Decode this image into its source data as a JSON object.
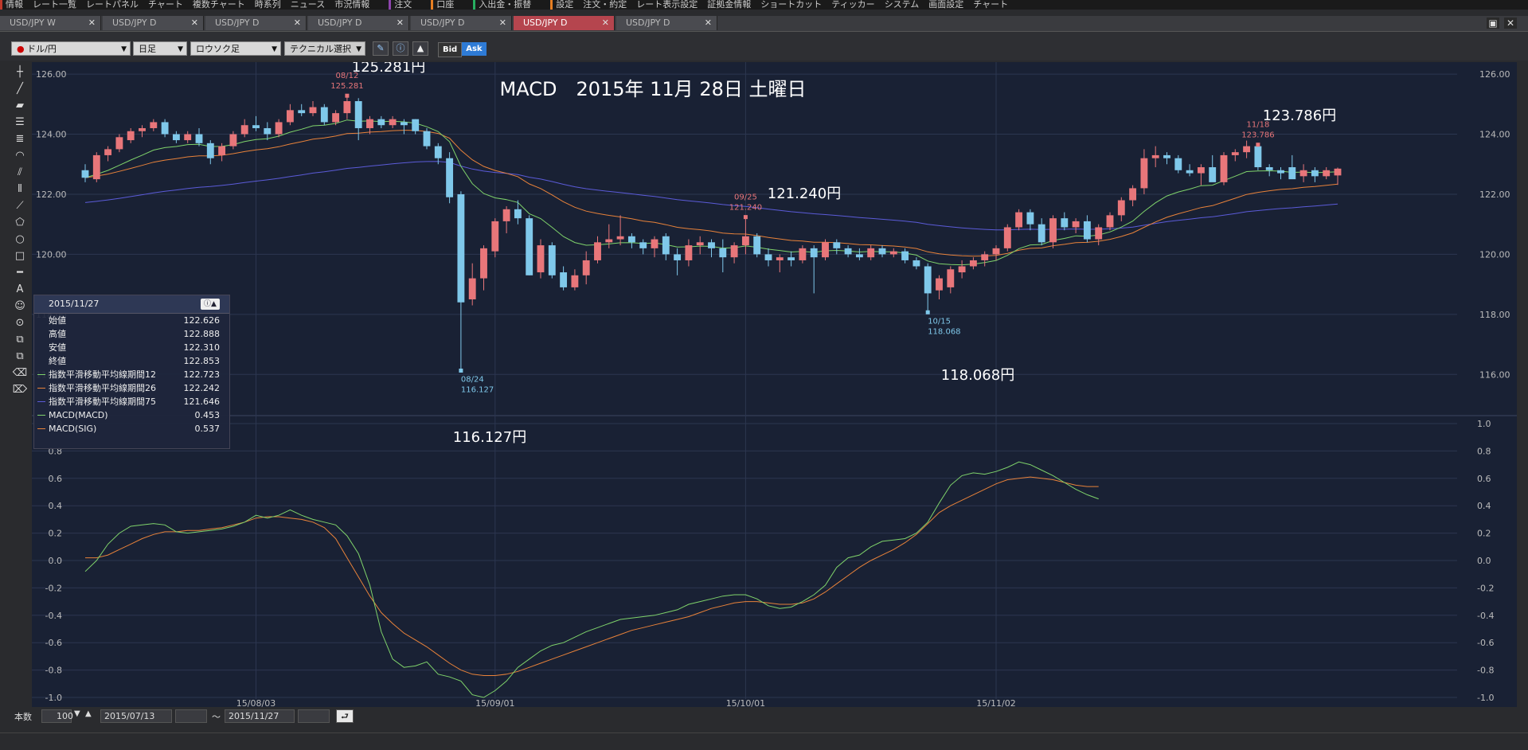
{
  "menu": {
    "groups": [
      {
        "items": [
          "情報",
          "レート一覧",
          "レートパネル",
          "チャート",
          "複数チャート",
          "時系列",
          "ニュース",
          "市況情報"
        ]
      },
      {
        "items": [
          "注文"
        ]
      },
      {
        "items": [
          "口座"
        ]
      },
      {
        "items": [
          "入出金・振替"
        ]
      },
      {
        "items": [
          "設定",
          "注文・約定",
          "レート表示設定",
          "証拠金情報",
          "ショートカット",
          "ティッカー",
          "システム",
          "画面設定",
          "チャート"
        ]
      }
    ]
  },
  "tabs": [
    {
      "label": "USD/JPY W",
      "active": false
    },
    {
      "label": "USD/JPY D",
      "active": false
    },
    {
      "label": "USD/JPY D",
      "active": false
    },
    {
      "label": "USD/JPY D",
      "active": false
    },
    {
      "label": "USD/JPY D",
      "active": false
    },
    {
      "label": "USD/JPY D",
      "active": true
    },
    {
      "label": "USD/JPY D",
      "active": false
    }
  ],
  "toolbar": {
    "pair": "ドル/円",
    "timeframe": "日足",
    "chart_type": "ロウソク足",
    "technical": "テクニカル選択",
    "bid": "Bid",
    "ask": "Ask"
  },
  "chart_title": "MACD　2015年 11月 28日 土曜日",
  "annotations": [
    {
      "big": "125.281円",
      "date": "08/12",
      "price": "125.281"
    },
    {
      "big": "121.240円",
      "date": "09/25",
      "price": "121.240"
    },
    {
      "big": "123.786円",
      "date": "11/18",
      "price": "123.786"
    },
    {
      "big": "116.127円",
      "date": "08/24",
      "price": "116.127"
    },
    {
      "big": "118.068円",
      "date": "10/15",
      "price": "118.068"
    }
  ],
  "info": {
    "date": "2015/11/27",
    "rows": [
      {
        "label": "始値",
        "value": "122.626"
      },
      {
        "label": "高値",
        "value": "122.888"
      },
      {
        "label": "安値",
        "value": "122.310"
      },
      {
        "label": "終値",
        "value": "122.853"
      },
      {
        "label": "指数平滑移動平均線期間12",
        "value": "122.723",
        "color": "#7fd36b"
      },
      {
        "label": "指数平滑移動平均線期間26",
        "value": "122.242",
        "color": "#e8823a"
      },
      {
        "label": "指数平滑移動平均線期間75",
        "value": "121.646",
        "color": "#5b5bd8"
      },
      {
        "label": "MACD(MACD)",
        "value": "0.453",
        "color": "#7fd36b"
      },
      {
        "label": "MACD(SIG)",
        "value": "0.537",
        "color": "#e8823a"
      }
    ]
  },
  "bottom": {
    "count_label": "本数",
    "count": "100",
    "from": "2015/07/13",
    "tilde": "～",
    "to": "2015/11/27"
  },
  "chart_data": {
    "type": "candlestick",
    "price_ticks": [
      "126.00",
      "124.00",
      "122.00",
      "120.00",
      "118.00",
      "116.00"
    ],
    "price_range": [
      115.0,
      126.4
    ],
    "macd_ticks": [
      "1.0",
      "0.8",
      "0.6",
      "0.4",
      "0.2",
      "0.0",
      "-0.2",
      "-0.4",
      "-0.6",
      "-0.8",
      "-1.0"
    ],
    "macd_range": [
      -1.0,
      1.0
    ],
    "x_labels": [
      {
        "label": "15/08/03",
        "index": 15
      },
      {
        "label": "15/09/01",
        "index": 36
      },
      {
        "label": "15/10/01",
        "index": 58
      },
      {
        "label": "15/11/02",
        "index": 80
      }
    ],
    "ohlc": [
      [
        122.8,
        123.0,
        122.4,
        122.55
      ],
      [
        122.5,
        123.4,
        122.4,
        123.3
      ],
      [
        123.3,
        123.6,
        123.1,
        123.5
      ],
      [
        123.5,
        124.0,
        123.4,
        123.9
      ],
      [
        123.8,
        124.2,
        123.7,
        124.1
      ],
      [
        124.1,
        124.3,
        123.9,
        124.2
      ],
      [
        124.2,
        124.5,
        124.1,
        124.4
      ],
      [
        124.4,
        124.5,
        123.9,
        124.0
      ],
      [
        124.0,
        124.1,
        123.7,
        123.8
      ],
      [
        123.8,
        124.1,
        123.7,
        124.0
      ],
      [
        124.0,
        124.2,
        123.6,
        123.7
      ],
      [
        123.7,
        123.8,
        123.0,
        123.2
      ],
      [
        123.3,
        123.7,
        123.1,
        123.6
      ],
      [
        123.6,
        124.1,
        123.5,
        124.0
      ],
      [
        124.0,
        124.5,
        123.9,
        124.3
      ],
      [
        124.3,
        124.6,
        124.1,
        124.2
      ],
      [
        124.2,
        124.4,
        123.8,
        124.0
      ],
      [
        124.0,
        124.5,
        123.9,
        124.4
      ],
      [
        124.4,
        125.0,
        124.3,
        124.8
      ],
      [
        124.8,
        125.0,
        124.6,
        124.7
      ],
      [
        124.7,
        125.1,
        124.6,
        124.9
      ],
      [
        124.9,
        125.0,
        124.3,
        124.4
      ],
      [
        124.4,
        124.8,
        124.3,
        124.7
      ],
      [
        124.7,
        125.281,
        124.5,
        125.1
      ],
      [
        125.1,
        125.2,
        123.8,
        124.2
      ],
      [
        124.2,
        124.6,
        124.0,
        124.5
      ],
      [
        124.5,
        124.6,
        124.2,
        124.3
      ],
      [
        124.3,
        124.6,
        124.2,
        124.5
      ],
      [
        124.4,
        124.5,
        124.0,
        124.3
      ],
      [
        124.5,
        124.5,
        124.0,
        124.1
      ],
      [
        124.1,
        124.2,
        123.5,
        123.6
      ],
      [
        123.6,
        123.7,
        123.0,
        123.2
      ],
      [
        123.2,
        123.4,
        121.7,
        121.9
      ],
      [
        122.0,
        122.1,
        116.127,
        118.4
      ],
      [
        118.5,
        119.7,
        118.3,
        119.2
      ],
      [
        119.2,
        120.3,
        118.8,
        120.2
      ],
      [
        120.1,
        121.2,
        119.9,
        121.1
      ],
      [
        121.1,
        121.6,
        120.7,
        121.5
      ],
      [
        121.5,
        121.8,
        121.0,
        121.2
      ],
      [
        121.2,
        121.3,
        119.3,
        119.3
      ],
      [
        119.4,
        120.5,
        119.2,
        120.3
      ],
      [
        120.3,
        120.4,
        119.2,
        119.3
      ],
      [
        119.4,
        119.6,
        118.8,
        118.9
      ],
      [
        118.9,
        119.5,
        118.8,
        119.3
      ],
      [
        119.3,
        120.1,
        119.0,
        119.8
      ],
      [
        119.8,
        120.6,
        119.7,
        120.4
      ],
      [
        120.4,
        121.0,
        120.2,
        120.5
      ],
      [
        120.5,
        121.3,
        120.3,
        120.6
      ],
      [
        120.6,
        120.7,
        120.2,
        120.4
      ],
      [
        120.4,
        120.5,
        120.0,
        120.2
      ],
      [
        120.2,
        120.6,
        119.9,
        120.5
      ],
      [
        120.6,
        120.7,
        119.8,
        120.0
      ],
      [
        120.0,
        120.2,
        119.3,
        119.8
      ],
      [
        119.8,
        120.5,
        119.6,
        120.3
      ],
      [
        120.3,
        120.6,
        120.0,
        120.4
      ],
      [
        120.4,
        120.5,
        119.9,
        120.2
      ],
      [
        120.2,
        120.5,
        119.4,
        119.9
      ],
      [
        119.9,
        120.4,
        119.7,
        120.3
      ],
      [
        120.3,
        121.24,
        120.0,
        120.6
      ],
      [
        120.6,
        120.7,
        119.9,
        120.0
      ],
      [
        120.0,
        120.2,
        119.6,
        119.8
      ],
      [
        119.8,
        120.0,
        119.4,
        119.9
      ],
      [
        119.9,
        120.1,
        119.6,
        119.8
      ],
      [
        119.8,
        120.3,
        119.7,
        120.2
      ],
      [
        120.2,
        120.3,
        118.7,
        119.9
      ],
      [
        119.9,
        120.5,
        119.8,
        120.4
      ],
      [
        120.4,
        120.5,
        120.0,
        120.2
      ],
      [
        120.2,
        120.3,
        119.9,
        120.0
      ],
      [
        120.0,
        120.2,
        119.8,
        119.9
      ],
      [
        119.9,
        120.3,
        119.8,
        120.2
      ],
      [
        120.2,
        120.3,
        119.9,
        120.0
      ],
      [
        120.0,
        120.2,
        119.9,
        120.1
      ],
      [
        120.1,
        120.2,
        119.7,
        119.8
      ],
      [
        119.8,
        119.9,
        119.5,
        119.6
      ],
      [
        119.6,
        119.7,
        118.068,
        118.7
      ],
      [
        118.8,
        119.3,
        118.5,
        119.2
      ],
      [
        118.9,
        119.6,
        118.7,
        119.5
      ],
      [
        119.4,
        119.8,
        119.2,
        119.6
      ],
      [
        119.6,
        119.9,
        119.5,
        119.8
      ],
      [
        119.8,
        120.1,
        119.6,
        120.0
      ],
      [
        120.0,
        120.3,
        119.8,
        120.2
      ],
      [
        120.2,
        121.0,
        120.1,
        120.9
      ],
      [
        120.9,
        121.5,
        120.8,
        121.4
      ],
      [
        121.4,
        121.5,
        120.8,
        121.0
      ],
      [
        121.0,
        121.2,
        120.3,
        120.4
      ],
      [
        120.4,
        121.3,
        120.2,
        121.2
      ],
      [
        121.2,
        121.4,
        120.8,
        120.9
      ],
      [
        120.9,
        121.2,
        120.7,
        121.1
      ],
      [
        121.1,
        121.3,
        120.4,
        120.5
      ],
      [
        120.5,
        121.0,
        120.3,
        120.9
      ],
      [
        120.9,
        121.4,
        120.8,
        121.3
      ],
      [
        121.3,
        121.9,
        121.1,
        121.8
      ],
      [
        121.8,
        122.3,
        121.6,
        122.2
      ],
      [
        122.2,
        123.5,
        122.0,
        123.2
      ],
      [
        123.2,
        123.6,
        122.9,
        123.3
      ],
      [
        123.3,
        123.4,
        123.0,
        123.2
      ],
      [
        123.2,
        123.3,
        122.7,
        122.8
      ],
      [
        122.8,
        123.0,
        122.6,
        122.7
      ],
      [
        122.7,
        123.0,
        122.3,
        122.9
      ],
      [
        122.9,
        123.3,
        122.5,
        122.4
      ],
      [
        122.4,
        123.4,
        122.3,
        123.3
      ],
      [
        123.3,
        123.5,
        123.1,
        123.4
      ],
      [
        123.4,
        123.786,
        123.2,
        123.6
      ],
      [
        123.6,
        123.65,
        122.8,
        122.9
      ],
      [
        122.9,
        123.0,
        122.6,
        122.8
      ],
      [
        122.8,
        122.9,
        122.5,
        122.7
      ],
      [
        122.9,
        123.3,
        122.6,
        122.5
      ],
      [
        122.6,
        123.0,
        122.4,
        122.8
      ],
      [
        122.8,
        122.9,
        122.4,
        122.6
      ],
      [
        122.6,
        122.9,
        122.5,
        122.8
      ],
      [
        122.626,
        122.888,
        122.31,
        122.853
      ]
    ],
    "macd": [
      -0.08,
      0.0,
      0.12,
      0.2,
      0.25,
      0.26,
      0.27,
      0.26,
      0.21,
      0.2,
      0.21,
      0.22,
      0.23,
      0.25,
      0.28,
      0.33,
      0.31,
      0.33,
      0.37,
      0.33,
      0.3,
      0.28,
      0.26,
      0.18,
      0.05,
      -0.18,
      -0.52,
      -0.72,
      -0.78,
      -0.77,
      -0.74,
      -0.83,
      -0.85,
      -0.88,
      -0.98,
      -1.0,
      -0.95,
      -0.88,
      -0.78,
      -0.72,
      -0.66,
      -0.62,
      -0.6,
      -0.56,
      -0.52,
      -0.49,
      -0.46,
      -0.43,
      -0.42,
      -0.41,
      -0.4,
      -0.38,
      -0.36,
      -0.32,
      -0.3,
      -0.28,
      -0.26,
      -0.25,
      -0.25,
      -0.28,
      -0.33,
      -0.35,
      -0.34,
      -0.3,
      -0.25,
      -0.18,
      -0.05,
      0.02,
      0.04,
      0.1,
      0.14,
      0.15,
      0.16,
      0.2,
      0.28,
      0.42,
      0.55,
      0.62,
      0.64,
      0.63,
      0.65,
      0.68,
      0.72,
      0.7,
      0.66,
      0.62,
      0.57,
      0.52,
      0.48,
      0.45
    ],
    "signal": [
      0.02,
      0.02,
      0.04,
      0.08,
      0.12,
      0.16,
      0.19,
      0.21,
      0.21,
      0.22,
      0.22,
      0.23,
      0.24,
      0.26,
      0.28,
      0.31,
      0.32,
      0.32,
      0.31,
      0.3,
      0.28,
      0.24,
      0.16,
      0.02,
      -0.12,
      -0.26,
      -0.38,
      -0.46,
      -0.53,
      -0.58,
      -0.63,
      -0.69,
      -0.75,
      -0.8,
      -0.83,
      -0.84,
      -0.84,
      -0.83,
      -0.81,
      -0.78,
      -0.75,
      -0.72,
      -0.69,
      -0.66,
      -0.63,
      -0.6,
      -0.57,
      -0.54,
      -0.51,
      -0.49,
      -0.47,
      -0.45,
      -0.43,
      -0.41,
      -0.38,
      -0.35,
      -0.33,
      -0.31,
      -0.3,
      -0.3,
      -0.31,
      -0.32,
      -0.32,
      -0.31,
      -0.28,
      -0.23,
      -0.17,
      -0.11,
      -0.05,
      0.0,
      0.04,
      0.08,
      0.13,
      0.19,
      0.27,
      0.35,
      0.4,
      0.44,
      0.48,
      0.52,
      0.56,
      0.59,
      0.6,
      0.61,
      0.6,
      0.59,
      0.57,
      0.55,
      0.54,
      0.54
    ]
  }
}
